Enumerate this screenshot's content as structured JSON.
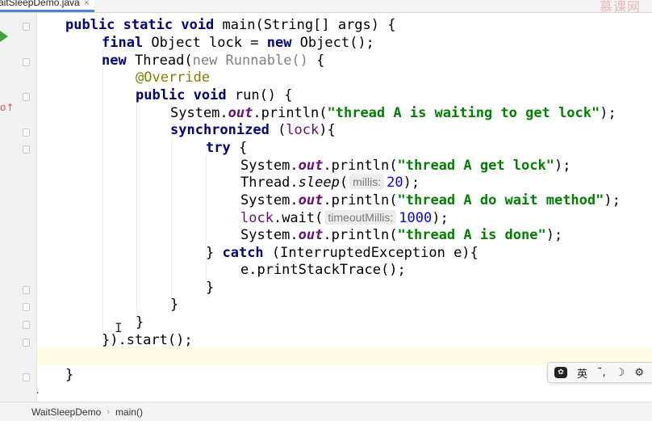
{
  "tab": {
    "label": "aitSleepDemo.java",
    "close": "×"
  },
  "watermark": "慕课网",
  "code": {
    "l1_kw1": "public",
    "l1_kw2": "static",
    "l1_kw3": "void",
    "l1_rest": " main(String[] args) {",
    "l2_kw1": "final",
    "l2_mid": " Object lock = ",
    "l2_kw2": "new",
    "l2_rest": " Object();",
    "l3_kw1": "new",
    "l3_mid": " Thread(",
    "l3_gray": "new Runnable()",
    "l3_rest": " {",
    "l4_ann": "@Override",
    "l5_kw1": "public",
    "l5_kw2": "void",
    "l5_rest": " run() {",
    "l6_a": "System.",
    "l6_field": "out",
    "l6_b": ".println(",
    "l6_str": "\"thread A is waiting to get lock\"",
    "l6_c": ");",
    "l7_kw": "synchronized",
    "l7_a": " (",
    "l7_lock": "lock",
    "l7_b": "){",
    "l8_kw": "try",
    "l8_rest": " {",
    "l9_a": "System.",
    "l9_field": "out",
    "l9_b": ".println(",
    "l9_str": "\"thread A get lock\"",
    "l9_c": ");",
    "l10_a": "Thread.",
    "l10_ital": "sleep",
    "l10_b": "(",
    "l10_hint": "millis:",
    "l10_num": "20",
    "l10_c": ");",
    "l11_a": "System.",
    "l11_field": "out",
    "l11_b": ".println(",
    "l11_str": "\"thread A do wait method\"",
    "l11_c": ");",
    "l12_lock": "lock",
    "l12_a": ".wait(",
    "l12_hint": "timeoutMillis:",
    "l12_num": "1000",
    "l12_b": ");",
    "l13_a": "System.",
    "l13_field": "out",
    "l13_b": ".println(",
    "l13_str": "\"thread A is done\"",
    "l13_c": ");",
    "l14_a": "} ",
    "l14_kw": "catch",
    "l14_rest": " (InterruptedException e){",
    "l15": "e.printStackTrace();",
    "l16": "}",
    "l17": "}",
    "l18": "}",
    "l19": "}).start();",
    "l21": "}",
    "l22": "}"
  },
  "ime": {
    "lang": "英",
    "punct": "˜,",
    "moon": "☽",
    "gear": "⚙"
  },
  "breadcrumb": {
    "class": "WaitSleepDemo",
    "separator": "›",
    "method": "main()"
  },
  "colors": {
    "keyword": "#000080",
    "string": "#008000",
    "number": "#0000ff",
    "annotation": "#808000",
    "field": "#660e7a",
    "current_line": "#fffae3"
  }
}
